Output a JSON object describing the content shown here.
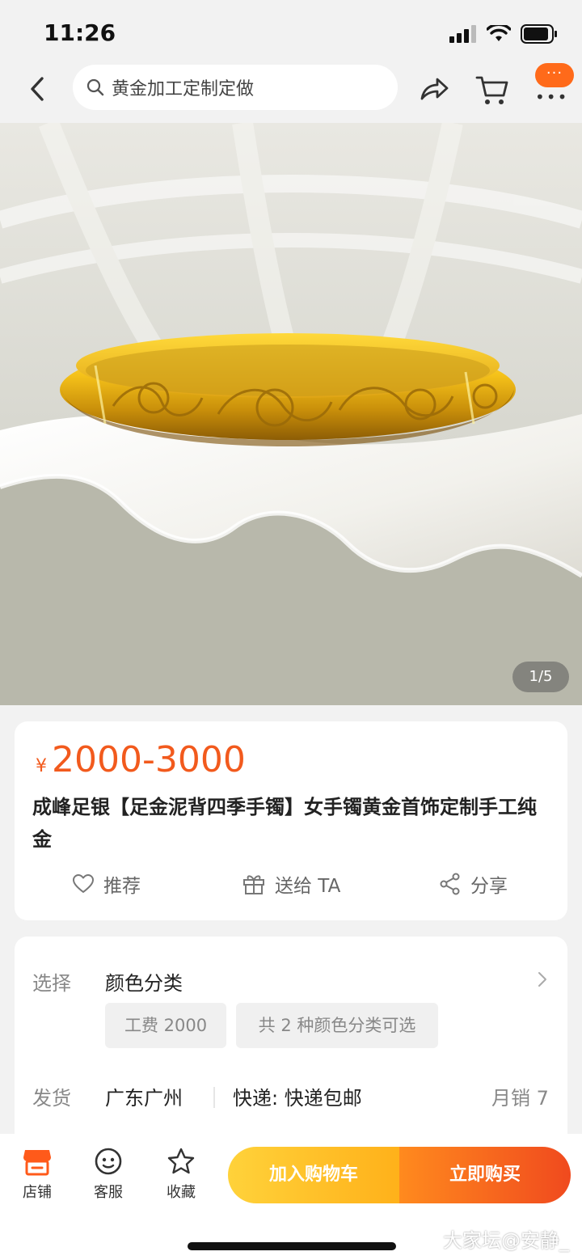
{
  "status_bar": {
    "time": "11:26"
  },
  "search": {
    "query": "黄金加工定制定做"
  },
  "product": {
    "image_counter": "1/5",
    "price_currency": "¥",
    "price": "2000-3000",
    "title": "成峰足银【足金泥背四季手镯】女手镯黄金首饰定制手工纯金"
  },
  "actions": {
    "recommend": "推荐",
    "gift": "送给 TA",
    "share": "分享"
  },
  "options": {
    "select_label": "选择",
    "select_value": "颜色分类",
    "chips": [
      "工费 2000",
      "共 2 种颜色分类可选"
    ],
    "ship_label": "发货",
    "ship_origin": "广东广州",
    "ship_method": "快递: 快递包邮",
    "monthly_sales": "月销 7"
  },
  "bottom_bar": {
    "shop": "店铺",
    "service": "客服",
    "favorite": "收藏",
    "add_to_cart": "加入购物车",
    "buy_now": "立即购买"
  },
  "watermark": "大家坛@安静_",
  "colors": {
    "accent": "#f25a1d",
    "cart_button": "#ffc02a",
    "buy_button": "#f0561e",
    "shop_icon": "#ff5a1a"
  }
}
